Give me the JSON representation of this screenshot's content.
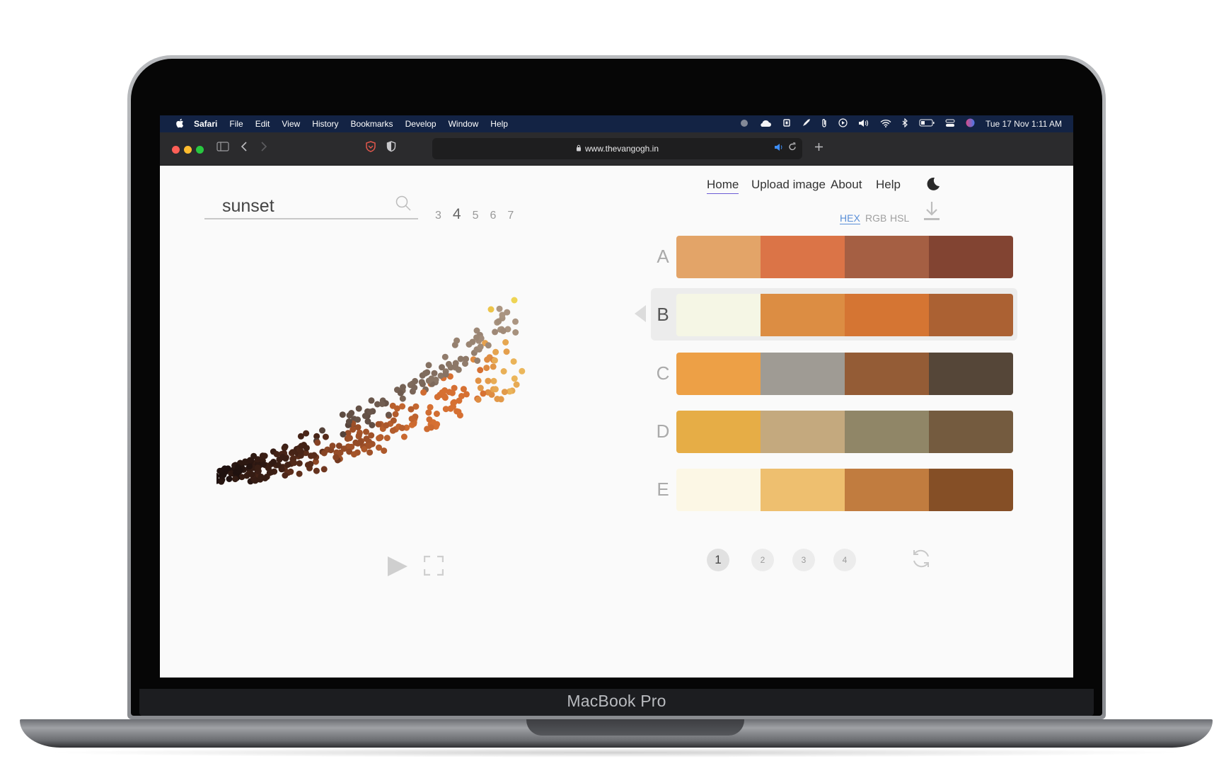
{
  "device": {
    "label": "MacBook Pro"
  },
  "menubar": {
    "items": [
      "Safari",
      "File",
      "Edit",
      "View",
      "History",
      "Bookmarks",
      "Develop",
      "Window",
      "Help"
    ],
    "status_icons": [
      "record-icon",
      "cloud-icon",
      "chip-icon",
      "rocket-icon",
      "paperclip-icon",
      "play-icon",
      "volume-icon",
      "wifi-icon",
      "bluetooth-icon",
      "battery-icon",
      "control-center-icon",
      "siri-icon"
    ],
    "datetime": "Tue 17 Nov  1:11 AM"
  },
  "browser": {
    "url": "www.thevangogh.in",
    "traffic_lights": [
      "#ff5f57",
      "#febc2e",
      "#28c840"
    ]
  },
  "nav": {
    "links": [
      "Home",
      "Upload image",
      "About",
      "Help"
    ],
    "active": "Home"
  },
  "search": {
    "value": "sunset"
  },
  "palette_sizes": {
    "options": [
      "3",
      "4",
      "5",
      "6",
      "7"
    ],
    "selected": "4"
  },
  "formats": {
    "options": [
      "HEX",
      "RGB",
      "HSL"
    ],
    "selected": "HEX"
  },
  "palettes": [
    {
      "label": "A",
      "colors": [
        "#e3a468",
        "#db7447",
        "#a55f43",
        "#824432"
      ]
    },
    {
      "label": "B",
      "colors": [
        "#f5f6e5",
        "#dc8d43",
        "#d57533",
        "#ab6133"
      ],
      "selected": true
    },
    {
      "label": "C",
      "colors": [
        "#eda046",
        "#9f9b94",
        "#945c36",
        "#554638"
      ]
    },
    {
      "label": "D",
      "colors": [
        "#e6ad46",
        "#c4a97e",
        "#908667",
        "#745b3f"
      ]
    },
    {
      "label": "E",
      "colors": [
        "#fcf7e5",
        "#eebf6f",
        "#c17c3f",
        "#854f26"
      ]
    }
  ],
  "pagination": {
    "pages": [
      "1",
      "2",
      "3",
      "4"
    ],
    "current": "1"
  },
  "icons": {
    "search": "search-icon",
    "theme": "moon-icon",
    "download": "download-icon",
    "play": "play-icon",
    "fullscreen": "fullscreen-icon",
    "refresh": "refresh-icon"
  }
}
